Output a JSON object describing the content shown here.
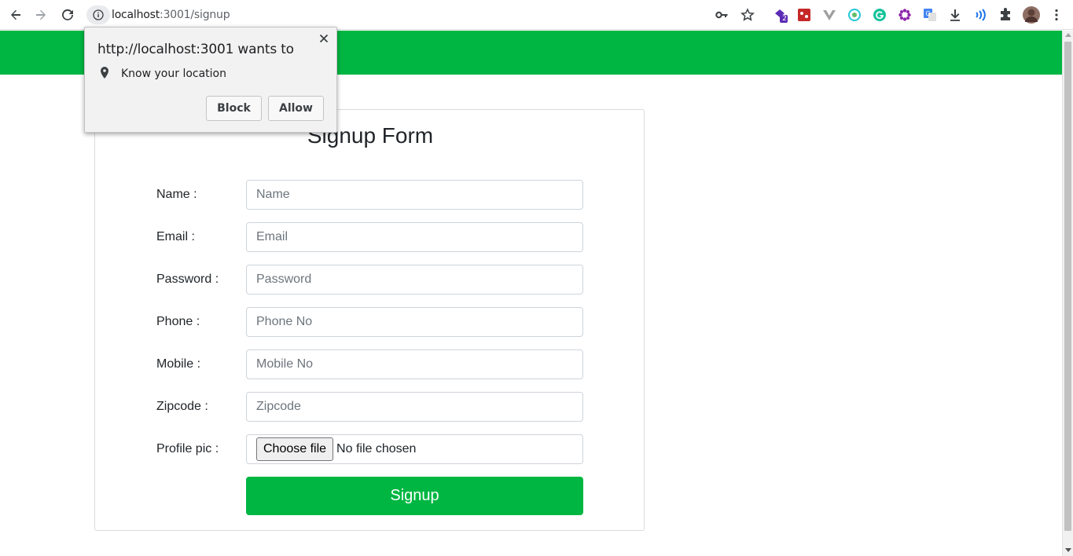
{
  "browser": {
    "url_host": "localhost",
    "url_path": ":3001/signup",
    "profile_badge_count": "2",
    "icons": [
      "back-icon",
      "forward-icon",
      "reload-icon",
      "info-icon",
      "key-icon",
      "star-icon",
      "extensions-icon",
      "menu-icon"
    ]
  },
  "popup": {
    "title": "http://localhost:3001 wants to",
    "permission": "Know your location",
    "block_label": "Block",
    "allow_label": "Allow"
  },
  "form": {
    "title": "Signup Form",
    "fields": [
      {
        "label": "Name :",
        "placeholder": "Name"
      },
      {
        "label": "Email :",
        "placeholder": "Email"
      },
      {
        "label": "Password :",
        "placeholder": "Password"
      },
      {
        "label": "Phone :",
        "placeholder": "Phone No"
      },
      {
        "label": "Mobile :",
        "placeholder": "Mobile No"
      },
      {
        "label": "Zipcode :",
        "placeholder": "Zipcode"
      }
    ],
    "profile_pic_label": "Profile pic :",
    "choose_file_label": "Choose file",
    "no_file_label": "No file chosen",
    "submit_label": "Signup"
  },
  "colors": {
    "brand_green": "#00b642",
    "popup_bg": "#f2f2f2"
  }
}
